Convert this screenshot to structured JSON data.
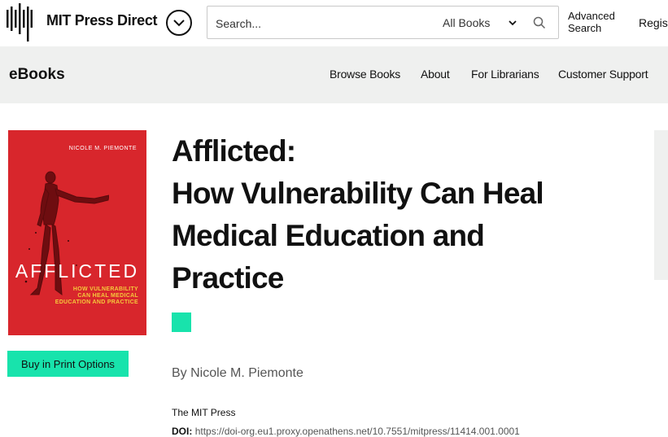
{
  "header": {
    "brand": "MIT Press Direct",
    "search": {
      "placeholder": "Search...",
      "scope": "All Books"
    },
    "advanced_search": [
      "Advanced",
      "Search"
    ],
    "register": "Register"
  },
  "subnav": {
    "section_title": "eBooks",
    "links": [
      "Browse Books",
      "About",
      "For Librarians",
      "Customer Support"
    ]
  },
  "book": {
    "cover": {
      "author": "NICOLE M. PIEMONTE",
      "title": "AFFLICTED",
      "subtitle": [
        "HOW VULNERABILITY",
        "CAN HEAL MEDICAL",
        "EDUCATION AND PRACTICE"
      ],
      "color": "#d8262c"
    },
    "buy_label": "Buy in Print Options",
    "title_lines": [
      "Afflicted:",
      "How Vulnerability Can Heal",
      "Medical Education and",
      "Practice"
    ],
    "by_label": "By",
    "author": "Nicole M. Piemonte",
    "publisher": "The MIT Press",
    "doi_label": "DOI:",
    "doi_url": "https://doi-org.eu1.proxy.openathens.net/10.7551/mitpress/11414.001.0001"
  },
  "colors": {
    "accent": "#18e3ac",
    "subnav_bg": "#eff0ef"
  }
}
